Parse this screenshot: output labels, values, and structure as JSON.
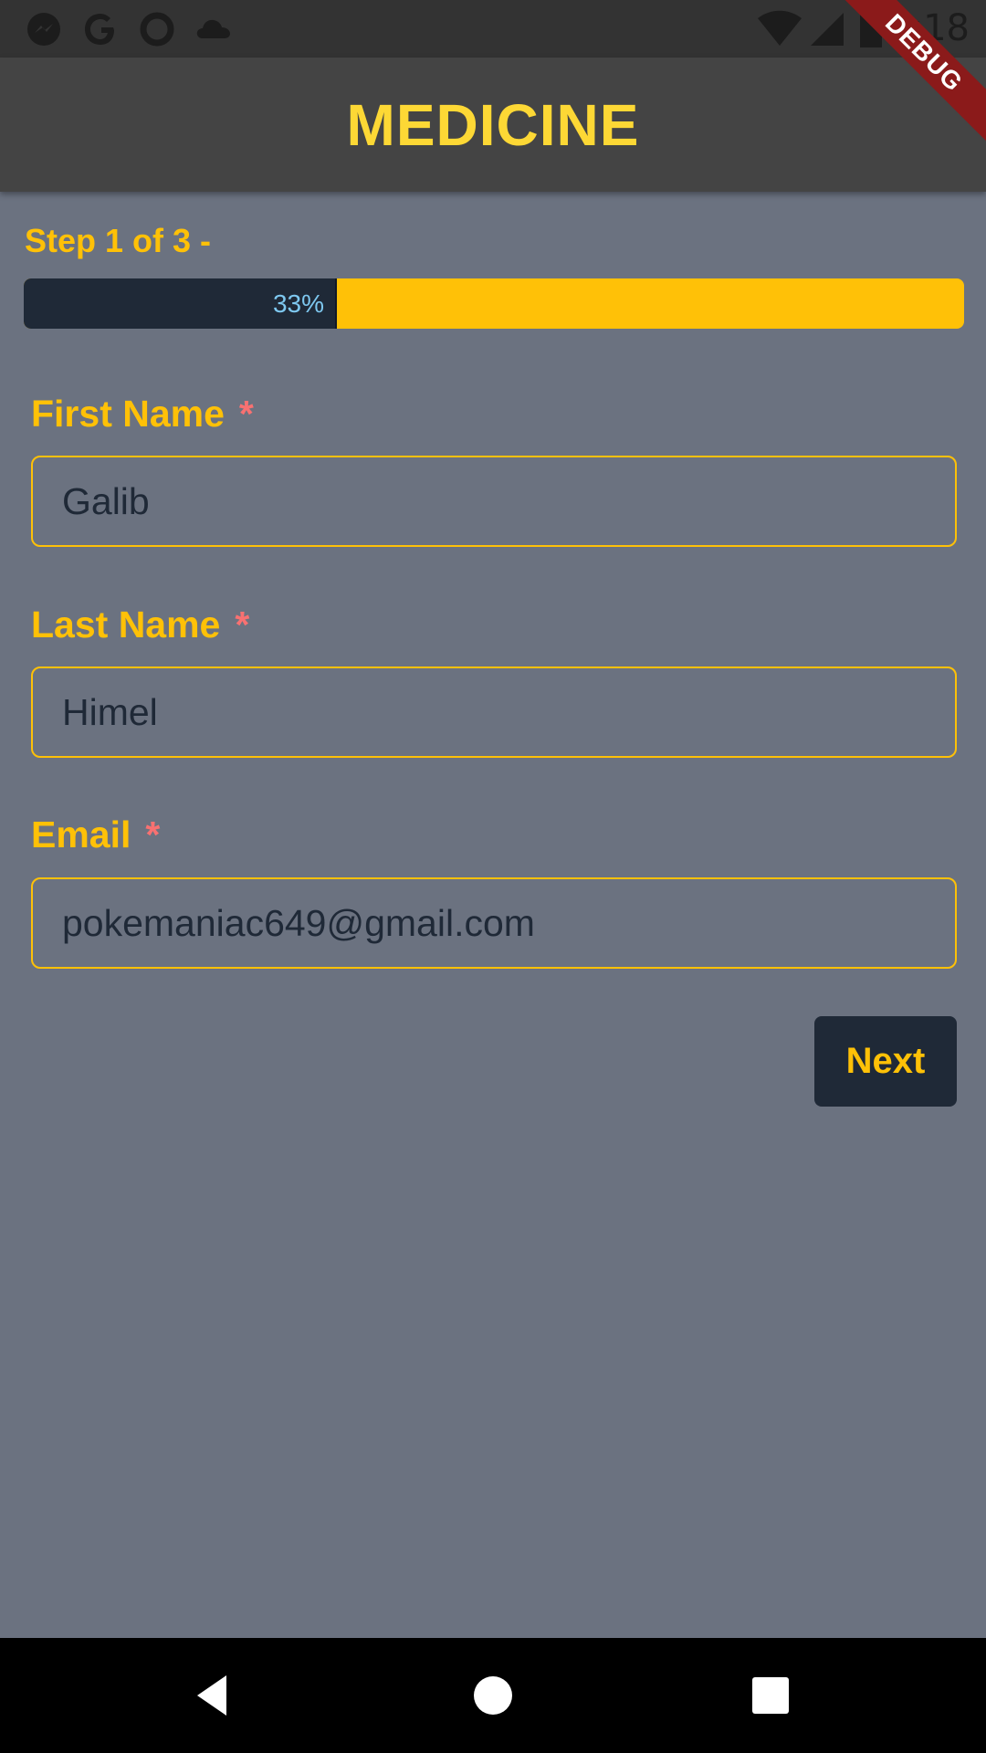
{
  "status_bar": {
    "time": "7:18",
    "left_icons": [
      "messenger-icon",
      "google-icon",
      "circle-icon",
      "cloud-icon"
    ],
    "right_icons": [
      "wifi-icon",
      "signal-icon",
      "battery-icon"
    ]
  },
  "app_bar": {
    "title": "MEDICINE"
  },
  "debug_banner": {
    "label": "DEBUG"
  },
  "progress": {
    "step_label": "Step 1 of 3 -",
    "percent_text": "33%",
    "fraction": 0.333
  },
  "form": {
    "first_name": {
      "label": "First Name",
      "required_mark": "*",
      "value": "Galib"
    },
    "last_name": {
      "label": "Last Name",
      "required_mark": "*",
      "value": "Himel"
    },
    "email": {
      "label": "Email",
      "required_mark": "*",
      "value": "pokemaniac649@gmail.com"
    }
  },
  "actions": {
    "next_label": "Next"
  },
  "nav_bar": {
    "icons": [
      "back-icon",
      "home-icon",
      "recents-icon"
    ]
  },
  "colors": {
    "accent": "#ffc107",
    "title": "#fdd835",
    "background": "#6b7280",
    "dark": "#1f2937",
    "required": "#f87171"
  }
}
